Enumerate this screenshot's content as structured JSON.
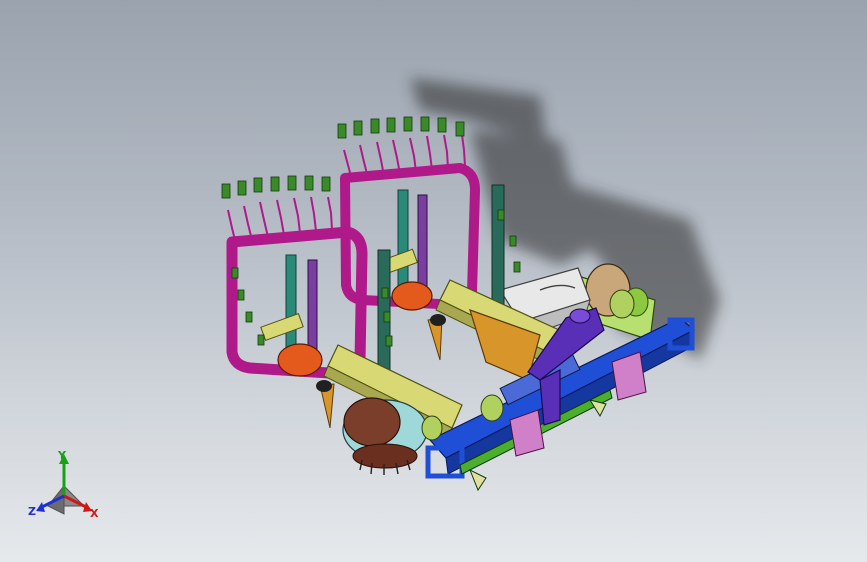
{
  "triad": {
    "x_label": "X",
    "y_label": "Y",
    "z_label": "Z",
    "x_color": "#d01818",
    "y_color": "#18a018",
    "z_color": "#2030d0"
  },
  "colors": {
    "frame_magenta": "#b0198a",
    "beam_yellow": "#d8d874",
    "tube_blue": "#1f4fd6",
    "hitch_purple": "#5a2fb8",
    "disc_orange": "#e35a1c",
    "drum_brown": "#7a3e2a",
    "post_teal": "#2a8a7a",
    "tooth_green": "#3a8a2a"
  }
}
